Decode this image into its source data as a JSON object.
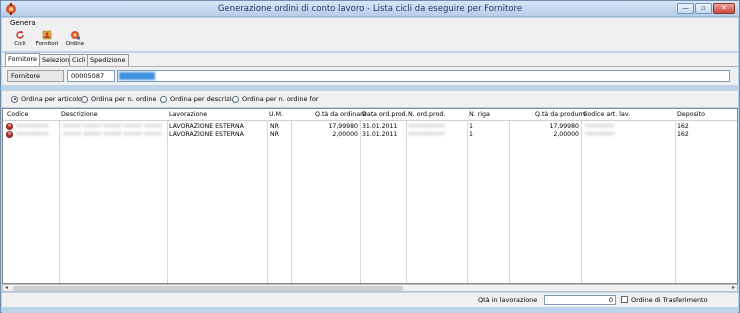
{
  "window": {
    "title": "Generazione ordini di conto lavoro - Lista cicli da eseguire per Fornitore",
    "minimize": "—",
    "restore": "▫",
    "close": "✕"
  },
  "menu": {
    "items": [
      "Genera"
    ]
  },
  "toolbar": {
    "buttons": [
      {
        "label": "Cicli",
        "icon": "refresh-icon"
      },
      {
        "label": "Fornitori",
        "icon": "supplier-icon"
      },
      {
        "label": "Ordine",
        "icon": "order-icon"
      }
    ]
  },
  "tabs": [
    "Fornitore",
    "Selezione",
    "Cicli",
    "Spedizione"
  ],
  "filter": {
    "label": "Fornitore",
    "code": "00005087",
    "name": "•••• ••••"
  },
  "sort": {
    "options": [
      "Ordina per articolo",
      "Ordina per n. ordine",
      "Ordina per descrizione",
      "Ordina per n. ordine for"
    ],
    "selected": 0
  },
  "grid": {
    "columns": [
      "Codice",
      "Descrizione",
      "Lavorazione",
      "U.M.",
      "Q.tà da ordinare",
      "Data ord.prod.",
      "N. ord.prod.",
      "N. riga",
      "Q.tà da produrre",
      "Codice art. lav.",
      "Deposito"
    ],
    "rows": [
      {
        "codice": "•••••••••",
        "descrizione": "••••• ••••• ••••• ••••• •••••",
        "lavorazione": "LAVORAZIONE ESTERNA",
        "um": "NR",
        "qta_ordinare": "17,99980",
        "data_ord": "31.01.2011",
        "n_ord": "••••••••••",
        "n_riga": "1",
        "qta_produrre": "17,99980",
        "cod_art_lav": "••••••••",
        "deposito": "162"
      },
      {
        "codice": "•••••••••",
        "descrizione": "••••• ••••• ••••• ••••• •••••",
        "lavorazione": "LAVORAZIONE ESTERNA",
        "um": "NR",
        "qta_ordinare": "2,00000",
        "data_ord": "31.01.2011",
        "n_ord": "••••••••••",
        "n_riga": "1",
        "qta_produrre": "2,00000",
        "cod_art_lav": "••••••••",
        "deposito": "162"
      }
    ]
  },
  "footer": {
    "qty_label": "Qtà in lavorazione",
    "qty_value": "0",
    "transfer_label": "Ordine di Trasferimento"
  },
  "colors": {
    "accent": "#3d8fe0",
    "frame": "#bcd3ea",
    "error_icon": "#c0312a"
  }
}
